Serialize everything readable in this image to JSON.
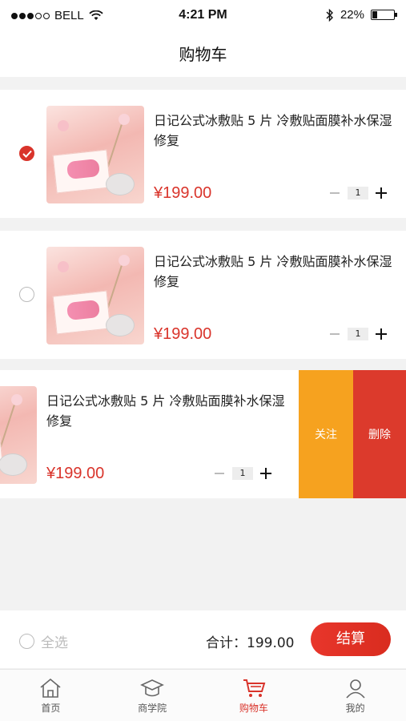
{
  "status": {
    "carrier": "BELL",
    "time": "4:21 PM",
    "battery": "22%"
  },
  "nav": {
    "title": "购物车"
  },
  "cart": {
    "items": [
      {
        "title": "日记公式冰敷贴 5 片  冷敷贴面膜补水保湿修复",
        "price": "¥199.00",
        "quantity": "1",
        "checked": true
      },
      {
        "title": "日记公式冰敷贴 5 片  冷敷贴面膜补水保湿修复",
        "price": "¥199.00",
        "quantity": "1",
        "checked": false
      },
      {
        "title": "日记公式冰敷贴 5 片  冷敷贴面膜补水保湿修复",
        "price": "¥199.00",
        "quantity": "1",
        "checked": false
      }
    ],
    "swipe_actions": {
      "follow": "关注",
      "delete": "删除"
    }
  },
  "summary": {
    "select_all": "全选",
    "total": "合计：199.00",
    "checkout": "结算"
  },
  "tabs": [
    {
      "label": "首页",
      "icon": "home-icon"
    },
    {
      "label": "商学院",
      "icon": "graduation-cap-icon"
    },
    {
      "label": "购物车",
      "icon": "cart-icon",
      "active": true
    },
    {
      "label": "我的",
      "icon": "user-icon"
    }
  ],
  "colors": {
    "accent": "#d9342b",
    "follow": "#f6a21f",
    "delete": "#dc3a2c"
  }
}
